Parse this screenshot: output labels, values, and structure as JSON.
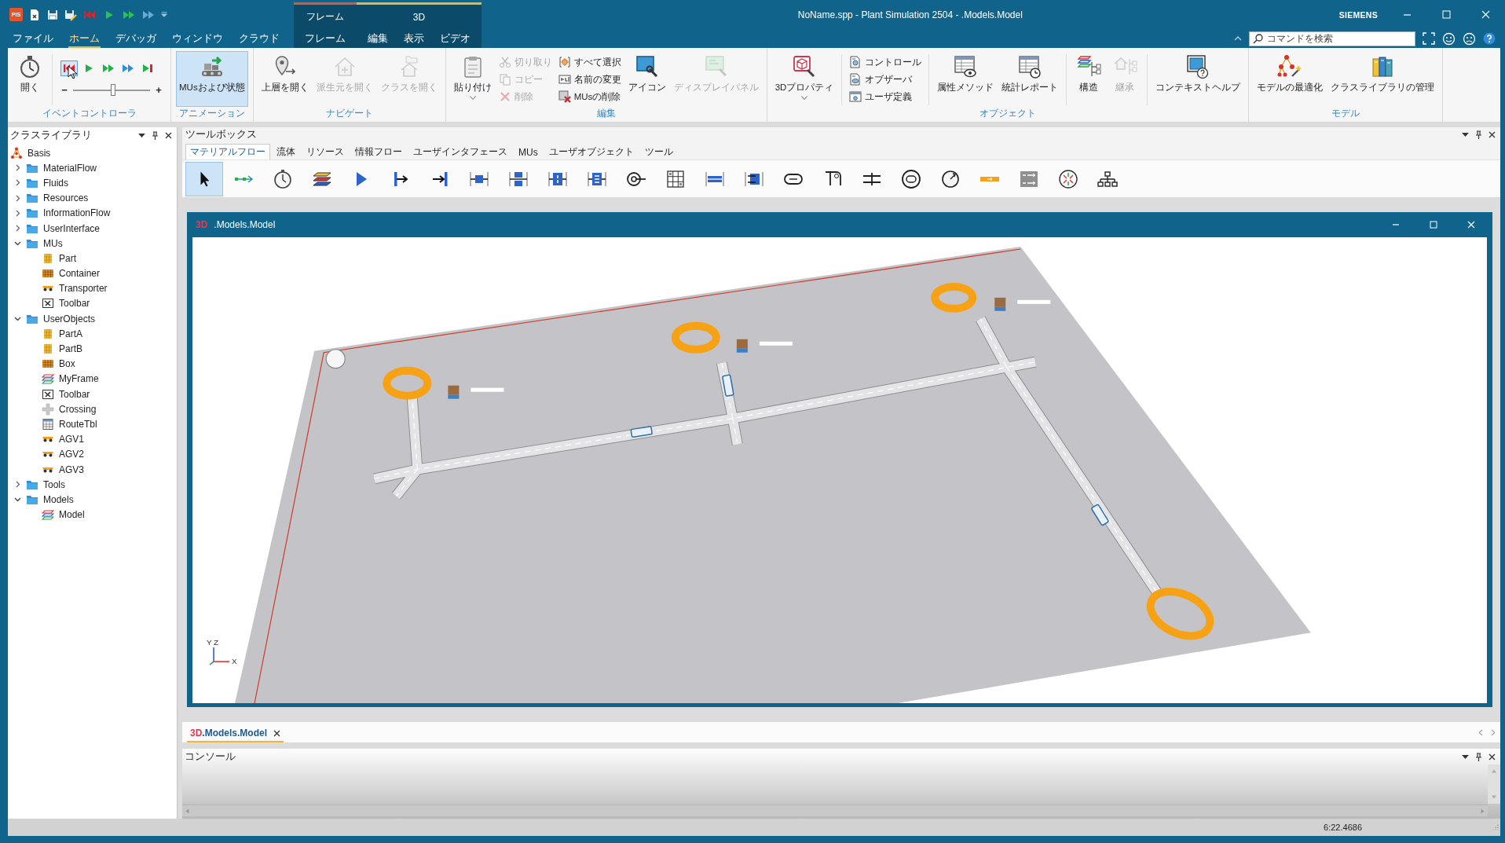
{
  "title_bar": {
    "logo": "PIS",
    "title": "NoName.spp - Plant Simulation 2504 - .Models.Model",
    "brand": "SIEMENS"
  },
  "menu_tabs": [
    {
      "label": "ファイル",
      "selected": false
    },
    {
      "label": "ホーム",
      "selected": true
    },
    {
      "label": "デバッガ",
      "selected": false
    },
    {
      "label": "ウィンドウ",
      "selected": false
    },
    {
      "label": "クラウド",
      "selected": false
    }
  ],
  "context_groups": [
    {
      "label": "フレーム",
      "color": "#e5562c",
      "tabs": [
        {
          "label": "フレーム",
          "selected": false
        }
      ]
    },
    {
      "label": "3D",
      "color": "#f2b330",
      "tabs": [
        {
          "label": "編集",
          "selected": false
        },
        {
          "label": "表示",
          "selected": false
        },
        {
          "label": "ビデオ",
          "selected": false
        }
      ]
    }
  ],
  "search": {
    "placeholder": "コマンドを検索"
  },
  "ribbon": {
    "groups": [
      {
        "label": "イベントコントローラ",
        "items": [
          {
            "kind": "large",
            "label": "開く",
            "disabled": false,
            "dropdown": false
          },
          {
            "kind": "separator"
          },
          {
            "kind": "event_controls",
            "buttons": [
              {
                "selected": true
              },
              {
                "selected": false
              },
              {
                "selected": false
              },
              {
                "selected": false
              },
              {
                "selected": false
              }
            ],
            "minus": "−",
            "plus": "+",
            "level": 0.52
          }
        ]
      },
      {
        "label": "アニメーション",
        "items": [
          {
            "kind": "large",
            "label": "MUsおよび状態",
            "disabled": false,
            "dropdown": false,
            "selected": true
          }
        ]
      },
      {
        "label": "ナビゲート",
        "items": [
          {
            "kind": "large",
            "label": "上層を開く",
            "disabled": false,
            "dropdown": false
          },
          {
            "kind": "large",
            "label": "派生元を開く",
            "disabled": true,
            "dropdown": false
          },
          {
            "kind": "large",
            "label": "クラスを開く",
            "disabled": true,
            "dropdown": false
          }
        ]
      },
      {
        "label": "編集",
        "items": [
          {
            "kind": "large",
            "label": "貼り付け",
            "disabled": false,
            "dropdown": true
          },
          {
            "kind": "stack",
            "items": [
              {
                "label": "切り取り",
                "disabled": true
              },
              {
                "label": "コピー",
                "disabled": true
              },
              {
                "label": "削除",
                "disabled": true
              }
            ]
          },
          {
            "kind": "stack",
            "items": [
              {
                "label": "すべて選択",
                "disabled": false
              },
              {
                "label": "名前の変更",
                "disabled": false
              },
              {
                "label": "MUsの削除",
                "disabled": false
              }
            ]
          },
          {
            "kind": "large",
            "label": "アイコン",
            "disabled": false,
            "dropdown": false
          },
          {
            "kind": "large",
            "label": "ディスプレイパネル",
            "disabled": true,
            "dropdown": false
          }
        ]
      },
      {
        "label": "オブジェクト",
        "items": [
          {
            "kind": "large",
            "label": "3Dプロパティ",
            "disabled": false,
            "dropdown": true
          },
          {
            "kind": "separator"
          },
          {
            "kind": "stack",
            "items": [
              {
                "label": "コントロール",
                "disabled": false
              },
              {
                "label": "オブザーバ",
                "disabled": false
              },
              {
                "label": "ユーザ定義",
                "disabled": false
              }
            ]
          },
          {
            "kind": "separator"
          },
          {
            "kind": "large",
            "label": "属性メソッド",
            "disabled": false,
            "dropdown": false
          },
          {
            "kind": "large",
            "label": "統計レポート",
            "disabled": false,
            "dropdown": false
          },
          {
            "kind": "separator"
          },
          {
            "kind": "large",
            "label": "構造",
            "disabled": false,
            "dropdown": false
          },
          {
            "kind": "large",
            "label": "継承",
            "disabled": true,
            "dropdown": false
          },
          {
            "kind": "separator"
          },
          {
            "kind": "large",
            "label": "コンテキストヘルプ",
            "disabled": false,
            "dropdown": false
          }
        ]
      },
      {
        "label": "モデル",
        "items": [
          {
            "kind": "large",
            "label": "モデルの最適化",
            "disabled": false,
            "dropdown": false
          },
          {
            "kind": "large",
            "label": "クラスライブラリの管理",
            "disabled": false,
            "dropdown": false
          }
        ]
      }
    ]
  },
  "class_library": {
    "title": "クラスライブラリ",
    "tree": [
      {
        "label": "Basis",
        "kind": "basis",
        "children": [
          {
            "label": "MaterialFlow",
            "kind": "folder",
            "expanded": false
          },
          {
            "label": "Fluids",
            "kind": "folder",
            "expanded": false
          },
          {
            "label": "Resources",
            "kind": "folder",
            "expanded": false
          },
          {
            "label": "InformationFlow",
            "kind": "folder",
            "expanded": false
          },
          {
            "label": "UserInterface",
            "kind": "folder",
            "expanded": false
          },
          {
            "label": "MUs",
            "kind": "folder",
            "expanded": true,
            "children": [
              {
                "label": "Part",
                "kind": "part"
              },
              {
                "label": "Container",
                "kind": "container"
              },
              {
                "label": "Transporter",
                "kind": "transporter"
              },
              {
                "label": "Toolbar",
                "kind": "toolbar"
              }
            ]
          },
          {
            "label": "UserObjects",
            "kind": "folder",
            "expanded": true,
            "children": [
              {
                "label": "PartA",
                "kind": "part"
              },
              {
                "label": "PartB",
                "kind": "part"
              },
              {
                "label": "Box",
                "kind": "container"
              },
              {
                "label": "MyFrame",
                "kind": "frame"
              },
              {
                "label": "Toolbar",
                "kind": "toolbar"
              },
              {
                "label": "Crossing",
                "kind": "crossing"
              },
              {
                "label": "RouteTbl",
                "kind": "table"
              },
              {
                "label": "AGV1",
                "kind": "transporter"
              },
              {
                "label": "AGV2",
                "kind": "transporter"
              },
              {
                "label": "AGV3",
                "kind": "transporter"
              }
            ]
          },
          {
            "label": "Tools",
            "kind": "folder",
            "expanded": false
          },
          {
            "label": "Models",
            "kind": "folder",
            "expanded": true,
            "children": [
              {
                "label": "Model",
                "kind": "frame"
              }
            ]
          }
        ]
      }
    ]
  },
  "toolbox": {
    "title": "ツールボックス",
    "tabs": [
      {
        "label": "マテリアルフロー",
        "selected": true
      },
      {
        "label": "流体",
        "selected": false
      },
      {
        "label": "リソース",
        "selected": false
      },
      {
        "label": "情報フロー",
        "selected": false
      },
      {
        "label": "ユーザインタフェース",
        "selected": false
      },
      {
        "label": "MUs",
        "selected": false
      },
      {
        "label": "ユーザオブジェクト",
        "selected": false
      },
      {
        "label": "ツール",
        "selected": false
      }
    ],
    "tools": [
      {
        "selected": true
      },
      {
        "selected": false
      },
      {
        "selected": false
      },
      {
        "selected": false
      },
      {
        "selected": false
      },
      {
        "selected": false
      },
      {
        "selected": false
      },
      {
        "selected": false
      },
      {
        "selected": false
      },
      {
        "selected": false
      },
      {
        "selected": false
      },
      {
        "selected": false
      },
      {
        "selected": false
      },
      {
        "selected": false
      },
      {
        "selected": false
      },
      {
        "selected": false
      },
      {
        "selected": false
      },
      {
        "selected": false
      },
      {
        "selected": false
      },
      {
        "selected": false
      },
      {
        "selected": false
      },
      {
        "selected": false
      },
      {
        "selected": false
      },
      {
        "selected": false
      }
    ]
  },
  "model_window": {
    "badge": "3D",
    "title": ".Models.Model",
    "axis_labels": [
      "Y",
      "Z",
      "X"
    ]
  },
  "document_tabs": [
    {
      "prefix": "3D",
      "label": ".Models.Model",
      "selected": true
    }
  ],
  "console": {
    "title": "コンソール"
  },
  "status_bar": {
    "time": "6:22.4686"
  }
}
